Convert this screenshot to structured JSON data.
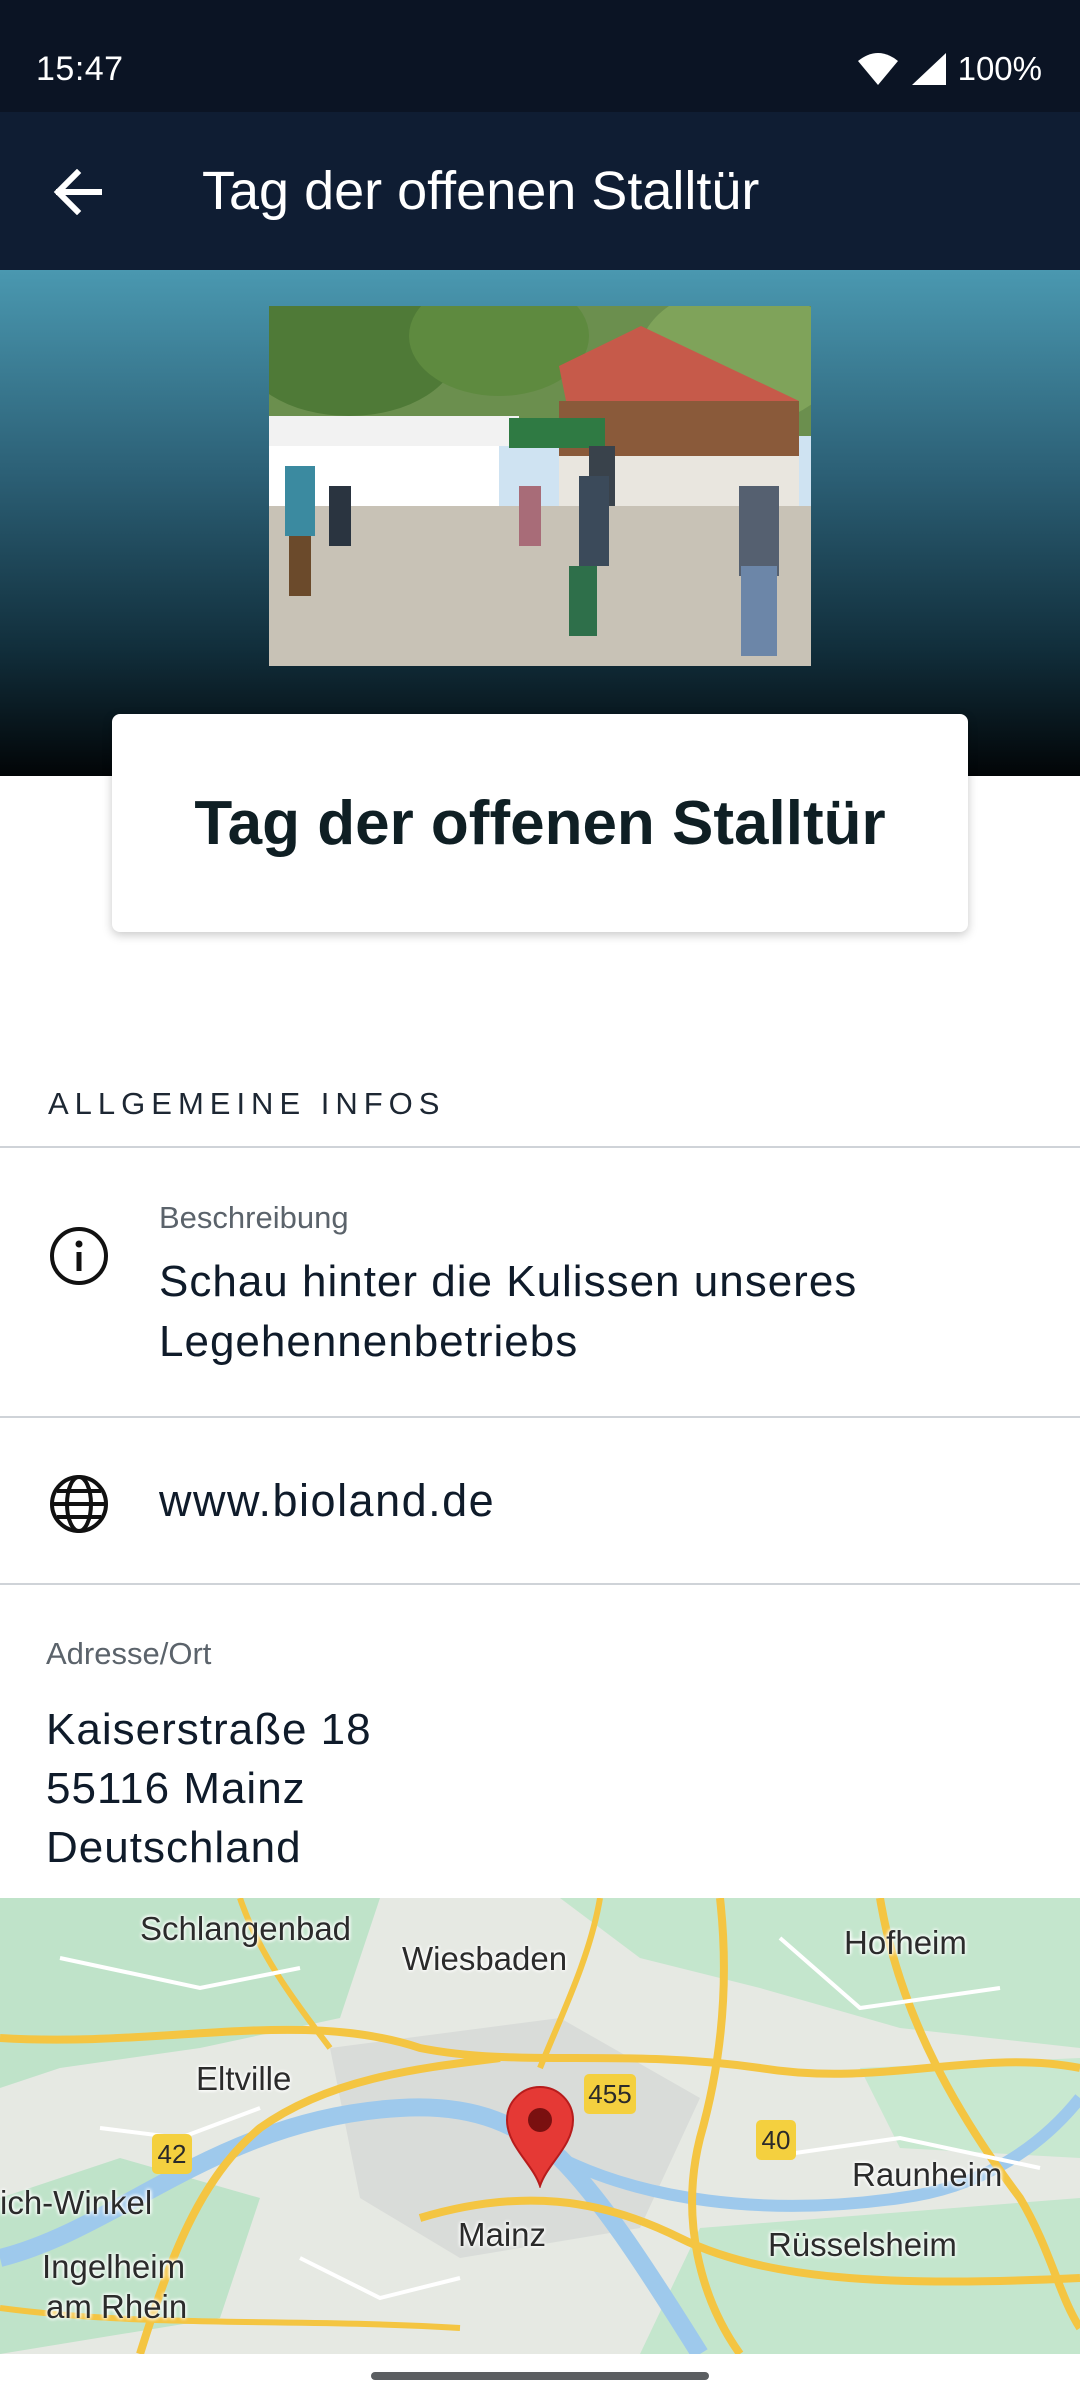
{
  "status_bar": {
    "time": "15:47",
    "battery": "100%"
  },
  "app_bar": {
    "title": "Tag der offenen Stalltür",
    "back_icon": "arrow-left-icon"
  },
  "hero": {
    "card_title": "Tag der offenen Stalltür"
  },
  "sections": {
    "general_header": "ALLGEMEINE INFOS",
    "description": {
      "label": "Beschreibung",
      "value": "Schau hinter die Kulissen unseres Legehennenbetriebs",
      "icon": "info-icon"
    },
    "website": {
      "value": "www.bioland.de",
      "icon": "globe-icon"
    },
    "address": {
      "label": "Adresse/Ort",
      "line1": "Kaiserstraße 18",
      "line2": "55116 Mainz",
      "line3": "Deutschland"
    }
  },
  "map": {
    "labels": {
      "schlangenbad": "Schlangenbad",
      "wiesbaden": "Wiesbaden",
      "hofheim": "Hofheim",
      "eltville": "Eltville",
      "winkel": "ich-Winkel",
      "ingelheim_1": "Ingelheim",
      "ingelheim_2": "am Rhein",
      "mainz": "Mainz",
      "raunheim": "Raunheim",
      "ruesselsheim": "Rüsselsheim"
    },
    "shields": {
      "a455": "455",
      "a42": "42",
      "a40": "40"
    },
    "pin_icon": "map-pin-icon"
  },
  "colors": {
    "app_bar": "#0f1d33",
    "status_bar": "#0b1424",
    "pin": "#e53935",
    "road": "#f4c542",
    "water": "#9ec9ec",
    "park": "#bfe3c9"
  }
}
